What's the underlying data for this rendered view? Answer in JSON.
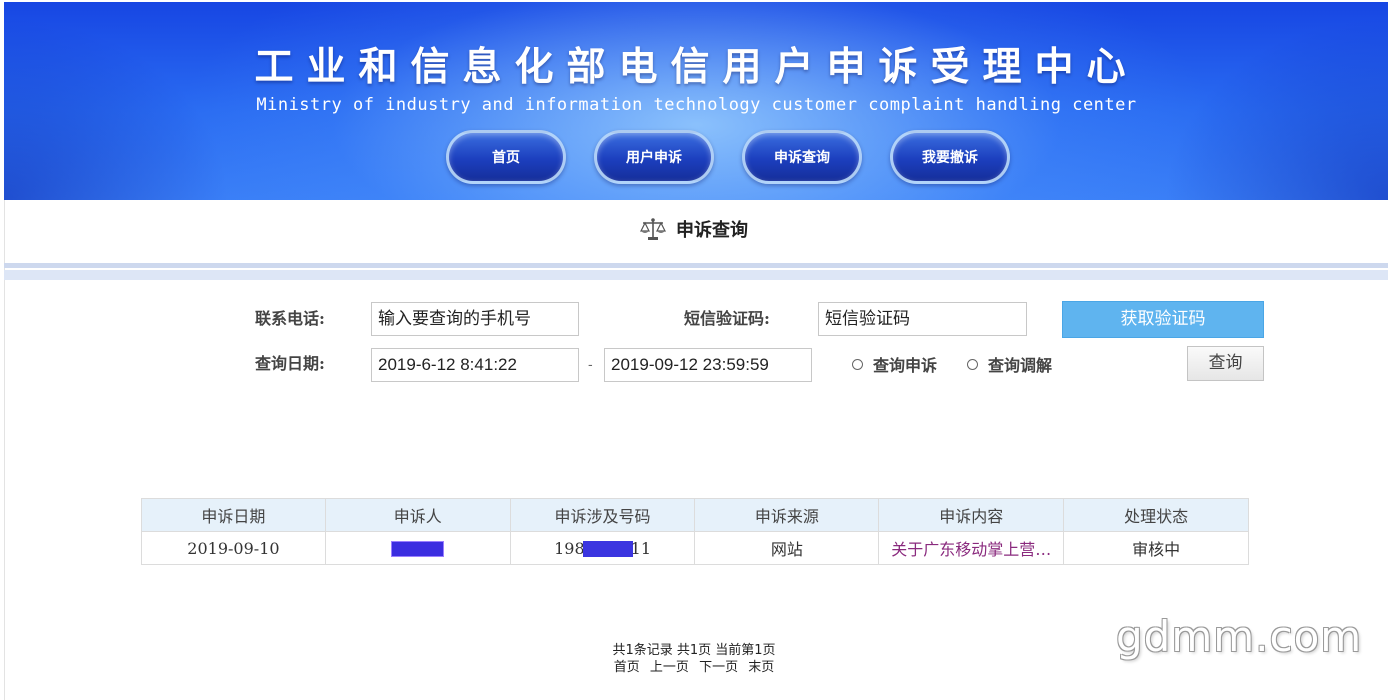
{
  "header": {
    "title": "工业和信息化部电信用户申诉受理中心",
    "subtitle": "Ministry of industry and information technology customer complaint handling center",
    "nav": [
      "首页",
      "用户申诉",
      "申诉查询",
      "我要撤诉"
    ]
  },
  "section": {
    "title": "申诉查询",
    "icon": "scale-icon"
  },
  "form": {
    "phone_label": "联系电话:",
    "phone_value": "输入要查询的手机号",
    "sms_label": "短信验证码:",
    "sms_value": "短信验证码",
    "get_code_button": "获取验证码",
    "date_label": "查询日期:",
    "date_start": "2019-6-12 8:41:22",
    "date_sep": "-",
    "date_end": "2019-09-12 23:59:59",
    "radio_complaint": "查询申诉",
    "radio_mediation": "查询调解",
    "query_button": "查询"
  },
  "table": {
    "headers": [
      "申诉日期",
      "申诉人",
      "申诉涉及号码",
      "申诉来源",
      "申诉内容",
      "处理状态"
    ],
    "rows": [
      {
        "date": "2019-09-10",
        "complainant": "",
        "number_prefix": "198",
        "number_suffix": "11",
        "source": "网站",
        "content": "关于广东移动掌上营…",
        "status": "审核中"
      }
    ]
  },
  "pagination": {
    "summary": "共1条记录 共1页 当前第1页",
    "first": "首页",
    "prev": "上一页",
    "next": "下一页",
    "last": "末页"
  },
  "watermark": "gdmm.com",
  "colors": {
    "banner": "#1f56ea",
    "accent_button": "#5fb4ef",
    "table_header": "#e6f1fa",
    "link": "#8a2a7e"
  }
}
